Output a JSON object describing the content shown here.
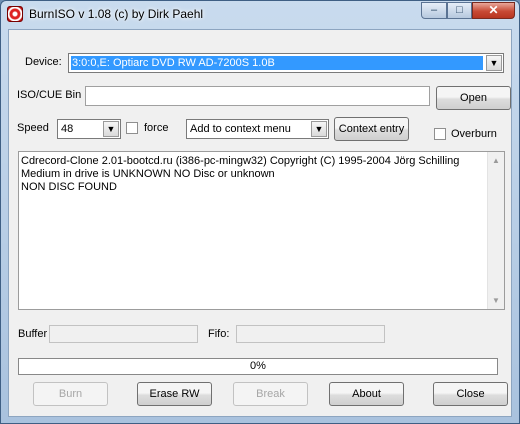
{
  "window": {
    "title": "BurnISO v 1.08 (c) by Dirk Paehl",
    "minimize_glyph": "–",
    "maximize_glyph": "□",
    "close_glyph": "✕"
  },
  "device": {
    "label": "Device:",
    "selected": "3:0:0,E: Optiarc DVD RW AD-7200S 1.0B"
  },
  "iso": {
    "label": "ISO/CUE Bin",
    "value": "",
    "open_label": "Open"
  },
  "speed": {
    "label": "Speed",
    "selected": "48",
    "force_label": "force",
    "force_checked": false
  },
  "context": {
    "selected": "Add to context menu",
    "button_label": "Context entry"
  },
  "overburn": {
    "label": "Overburn",
    "checked": false
  },
  "log": {
    "lines": [
      "Cdrecord-Clone 2.01-bootcd.ru (i386-pc-mingw32) Copyright (C) 1995-2004 Jörg Schilling",
      "Medium in drive is UNKNOWN NO Disc or unknown",
      "NON DISC FOUND"
    ]
  },
  "buffer": {
    "label": "Buffer",
    "value": ""
  },
  "fifo": {
    "label": "Fifo:",
    "value": ""
  },
  "progress": {
    "text": "0%",
    "fraction": 0
  },
  "buttons": {
    "burn": "Burn",
    "erase": "Erase RW",
    "break": "Break",
    "about": "About",
    "close": "Close"
  },
  "icons": {
    "dropdown": "▼",
    "scroll_up": "▲",
    "scroll_down": "▼"
  },
  "colors": {
    "selection": "#3399ff",
    "progress_fill": "#06b025",
    "close_button": "#c84a35"
  }
}
